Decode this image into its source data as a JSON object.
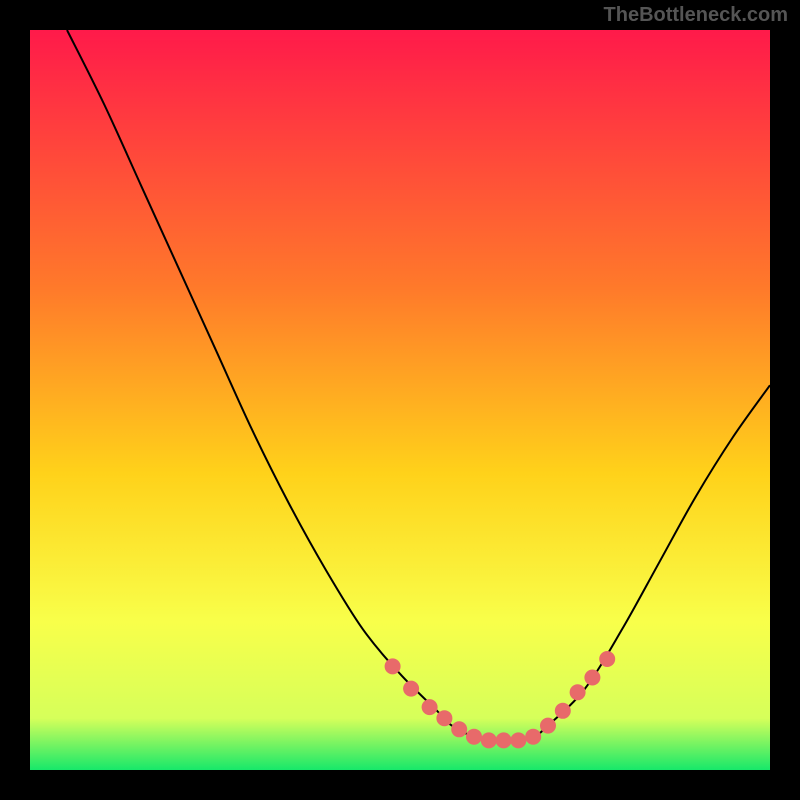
{
  "attribution": "TheBottleneck.com",
  "chart_data": {
    "type": "line",
    "title": "",
    "xlabel": "",
    "ylabel": "",
    "xlim": [
      0,
      100
    ],
    "ylim": [
      0,
      100
    ],
    "gradient_stops": [
      {
        "offset": 0,
        "color": "#ff1a4a"
      },
      {
        "offset": 35,
        "color": "#ff7a2a"
      },
      {
        "offset": 60,
        "color": "#ffd21a"
      },
      {
        "offset": 80,
        "color": "#f8ff4a"
      },
      {
        "offset": 93,
        "color": "#d6ff5a"
      },
      {
        "offset": 100,
        "color": "#17e86a"
      }
    ],
    "curve": {
      "x": [
        5,
        10,
        15,
        20,
        25,
        30,
        35,
        40,
        45,
        50,
        55,
        57,
        60,
        63,
        65,
        68,
        70,
        75,
        80,
        85,
        90,
        95,
        100
      ],
      "y": [
        100,
        90,
        79,
        68,
        57,
        46,
        36,
        27,
        19,
        13,
        8,
        6,
        4.5,
        4,
        4,
        4.5,
        6,
        11,
        19,
        28,
        37,
        45,
        52
      ]
    },
    "dots": {
      "x": [
        49,
        51.5,
        54,
        56,
        58,
        60,
        62,
        64,
        66,
        68,
        70,
        72,
        74,
        76,
        78
      ],
      "y": [
        14,
        11,
        8.5,
        7,
        5.5,
        4.5,
        4,
        4,
        4,
        4.5,
        6,
        8,
        10.5,
        12.5,
        15
      ]
    },
    "dot_color": "#e86a6a",
    "curve_color": "#000000"
  }
}
